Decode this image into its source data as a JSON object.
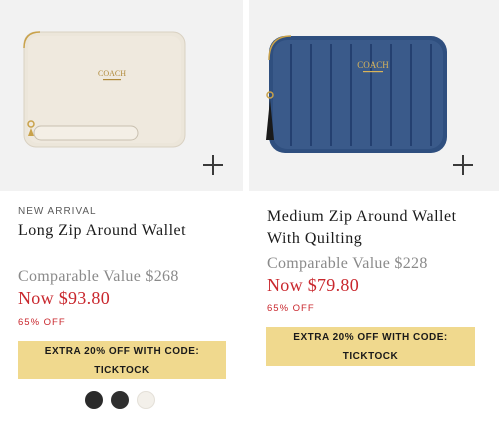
{
  "products": [
    {
      "badge": "NEW ARRIVAL",
      "title": "Long Zip Around Wallet",
      "comparable": "Comparable Value $268",
      "price": "Now $93.80",
      "discount": "65% OFF",
      "promo_line1": "EXTRA 20% OFF WITH CODE:",
      "promo_line2": "TICKTOCK",
      "image_logo": "COACH",
      "swatches": [
        {
          "name": "black",
          "color": "#2b2b2b"
        },
        {
          "name": "charcoal",
          "color": "#2f2f2f"
        },
        {
          "name": "chalk",
          "color": "#f3f0ea"
        }
      ]
    },
    {
      "title_line1": "Medium Zip Around Wallet",
      "title_line2": "With Quilting",
      "comparable": "Comparable Value $228",
      "price": "Now $79.80",
      "discount": "65% OFF",
      "promo_line1": "EXTRA 20% OFF WITH CODE:",
      "promo_line2": "TICKTOCK",
      "image_logo": "COACH"
    }
  ],
  "colors": {
    "sale_red": "#c9272d",
    "promo_bg": "#f0d98e",
    "image_bg": "#f2f2f2",
    "denim": "#2f4f7f"
  }
}
